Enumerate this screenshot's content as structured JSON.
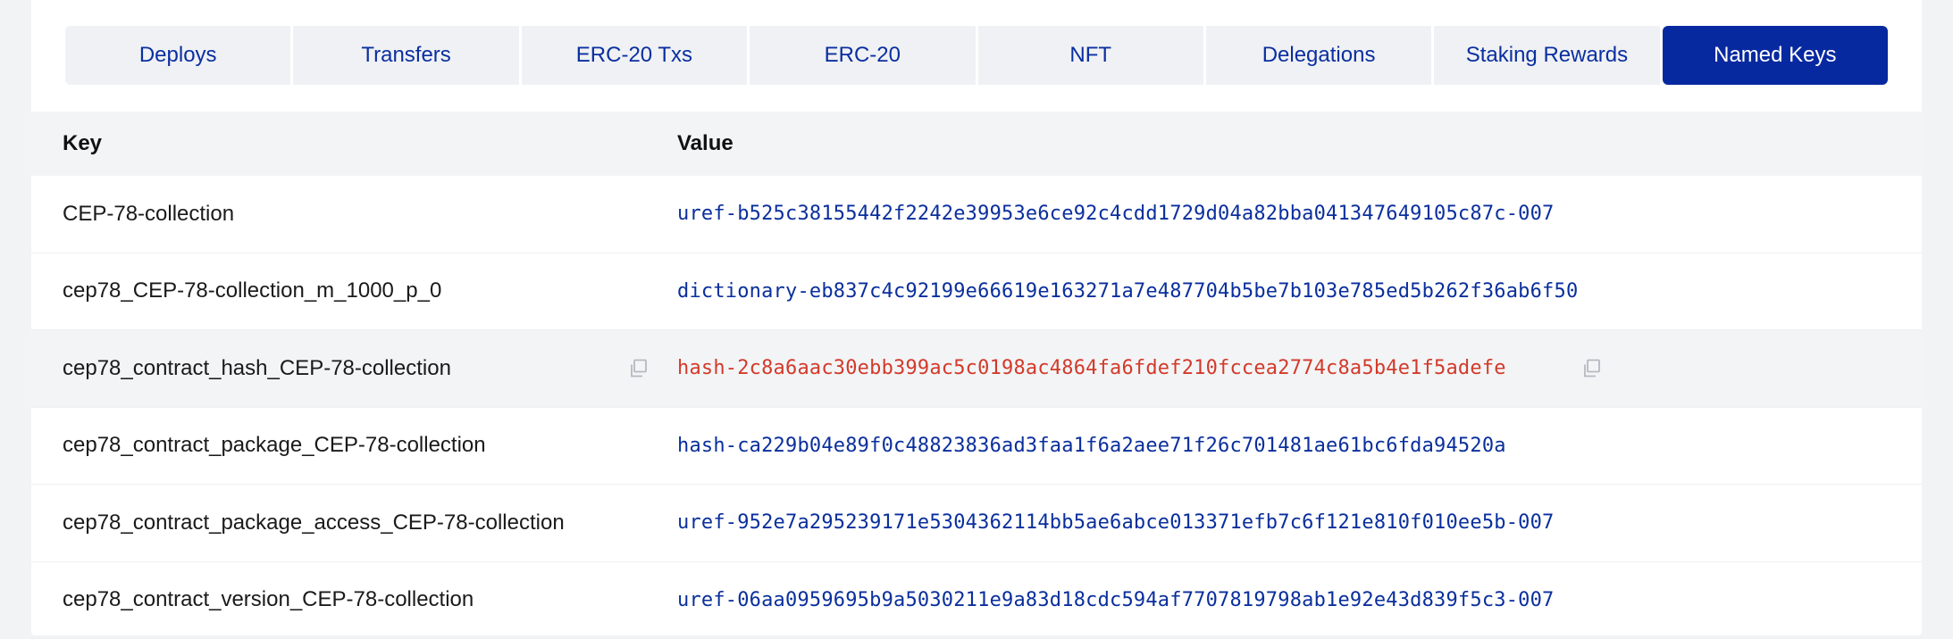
{
  "tabs": [
    {
      "label": "Deploys",
      "active": false
    },
    {
      "label": "Transfers",
      "active": false
    },
    {
      "label": "ERC-20 Txs",
      "active": false
    },
    {
      "label": "ERC-20",
      "active": false
    },
    {
      "label": "NFT",
      "active": false
    },
    {
      "label": "Delegations",
      "active": false
    },
    {
      "label": "Staking Rewards",
      "active": false
    },
    {
      "label": "Named Keys",
      "active": true
    }
  ],
  "table": {
    "headers": {
      "key": "Key",
      "value": "Value"
    },
    "rows": [
      {
        "key": "CEP-78-collection",
        "value": "uref-b525c38155442f2242e39953e6ce92c4cdd1729d04a82bba041347649105c87c-007"
      },
      {
        "key": "cep78_CEP-78-collection_m_1000_p_0",
        "value": "dictionary-eb837c4c92199e66619e163271a7e487704b5be7b103e785ed5b262f36ab6f50"
      },
      {
        "key": "cep78_contract_hash_CEP-78-collection",
        "value": "hash-2c8a6aac30ebb399ac5c0198ac4864fa6fdef210fccea2774c8a5b4e1f5adefe"
      },
      {
        "key": "cep78_contract_package_CEP-78-collection",
        "value": "hash-ca229b04e89f0c48823836ad3faa1f6a2aee71f26c701481ae61bc6fda94520a"
      },
      {
        "key": "cep78_contract_package_access_CEP-78-collection",
        "value": "uref-952e7a295239171e5304362114bb5ae6abce013371efb7c6f121e810f010ee5b-007"
      },
      {
        "key": "cep78_contract_version_CEP-78-collection",
        "value": "uref-06aa0959695b9a5030211e9a83d18cdc594af7707819798ab1e92e43d839f5c3-007"
      }
    ]
  },
  "icons": {
    "copy": "copy-icon"
  },
  "colors": {
    "accent": "#0729a0",
    "link": "#0a2f9c",
    "hover_value": "#d23a2a"
  }
}
